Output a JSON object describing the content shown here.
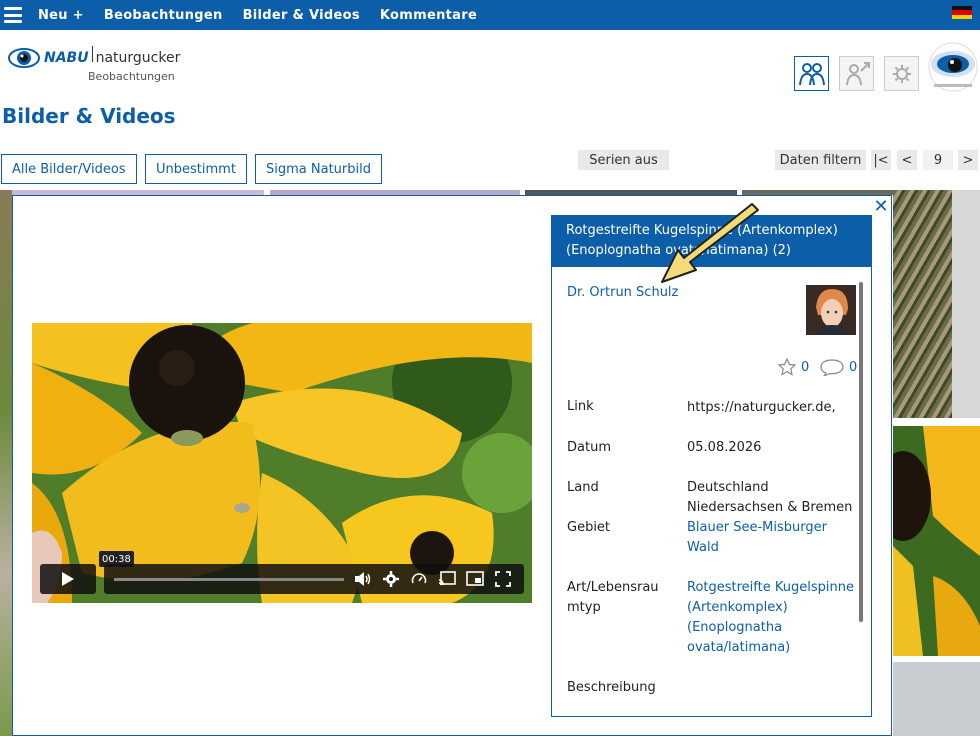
{
  "nav": {
    "items": [
      "Neu +",
      "Beobachtungen",
      "Bilder & Videos",
      "Kommentare"
    ],
    "menu_icon": "hamburger-icon",
    "language_icon": "german-flag-icon"
  },
  "header": {
    "logo_nabu": "NABU",
    "logo_name": "naturgucker",
    "logo_sub": "Beobachtungen",
    "icons": [
      "people-icon",
      "person-arrow-icon",
      "gear-icon",
      "naturgucker-badge-icon"
    ]
  },
  "page": {
    "title": "Bilder & Videos"
  },
  "filters": {
    "all_label": "Alle Bilder/Videos",
    "undetermined_label": "Unbestimmt",
    "sigma_label": "Sigma Naturbild",
    "series_label": "Serien aus",
    "filter_label": "Daten filtern",
    "first_label": "|<",
    "prev_label": "<",
    "page_number": "9",
    "next_label": ">"
  },
  "video": {
    "time_tooltip": "00:38",
    "progress": 0.0,
    "controls": [
      "play-icon",
      "volume-icon",
      "settings-icon",
      "speed-icon",
      "cast-icon",
      "picture-in-picture-icon",
      "fullscreen-icon"
    ]
  },
  "panel": {
    "title": "Rotgestreifte Kugelspinne (Artenkomplex) (Enoplognatha ovata/latimana) (2)",
    "author": "Dr. Ortrun Schulz",
    "likes": "0",
    "comments": "0",
    "fields": {
      "link_label": "Link",
      "link_value": "https://naturgucker.de,",
      "date_label": "Datum",
      "date_value": "05.08.2026",
      "country_label": "Land",
      "country_value": "Deutschland",
      "region_value": "Niedersachsen & Bremen",
      "area_label": "Gebiet",
      "area_value": "Blauer See-Misburger Wald",
      "species_label": "Art/Lebensraumtyp",
      "species_value": "Rotgestreifte Kugelspinne (Artenkomplex) (Enoplognatha ovata/latimana)",
      "description_label": "Beschreibung"
    }
  },
  "colors": {
    "brand": "#0d5ea8",
    "arrow": "#f2dc7a"
  }
}
